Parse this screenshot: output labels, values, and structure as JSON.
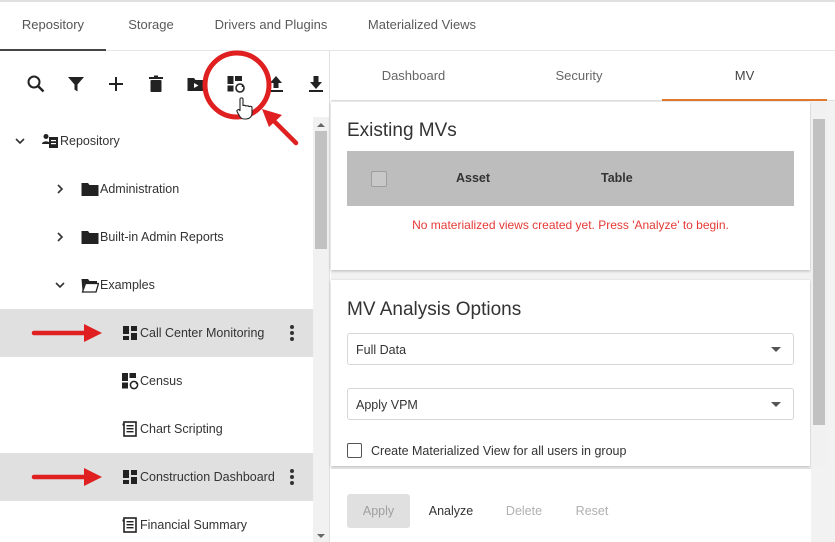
{
  "top_tabs": [
    {
      "label": "Repository",
      "active": true
    },
    {
      "label": "Storage",
      "active": false
    },
    {
      "label": "Drivers and Plugins",
      "active": false
    },
    {
      "label": "Materialized Views",
      "active": false
    }
  ],
  "toolbar": {
    "icons": [
      "search-icon",
      "filter-icon",
      "add-icon",
      "delete-icon",
      "move-folder-icon",
      "materialize-icon",
      "upload-icon",
      "download-icon"
    ]
  },
  "tree": {
    "items": [
      {
        "label": "Repository",
        "icon": "repository-icon",
        "expanded": true,
        "selected": false
      },
      {
        "label": "Administration",
        "icon": "folder-icon",
        "expanded": false,
        "selected": false
      },
      {
        "label": "Built-in Admin Reports",
        "icon": "folder-icon",
        "expanded": false,
        "selected": false
      },
      {
        "label": "Examples",
        "icon": "folder-open-icon",
        "expanded": true,
        "selected": false
      },
      {
        "label": "Call Center Monitoring",
        "icon": "dashboard-icon",
        "selected": true
      },
      {
        "label": "Census",
        "icon": "materialized-dashboard-icon",
        "selected": false
      },
      {
        "label": "Chart Scripting",
        "icon": "report-icon",
        "selected": false
      },
      {
        "label": "Construction Dashboard",
        "icon": "dashboard-icon",
        "selected": true
      },
      {
        "label": "Financial Summary",
        "icon": "report-icon",
        "selected": false
      }
    ]
  },
  "right_tabs": [
    {
      "label": "Dashboard",
      "active": false
    },
    {
      "label": "Security",
      "active": false
    },
    {
      "label": "MV",
      "active": true
    }
  ],
  "existing_mvs": {
    "title": "Existing MVs",
    "columns": [
      "Asset",
      "Table"
    ],
    "empty_message": "No materialized views created yet. Press 'Analyze' to begin."
  },
  "analysis": {
    "title": "MV Analysis Options",
    "data_select": "Full Data",
    "vpm_select": "Apply VPM",
    "checkbox_label": "Create Materialized View for all users in group",
    "checkbox_checked": false
  },
  "footer": {
    "apply": "Apply",
    "analyze": "Analyze",
    "delete": "Delete",
    "reset": "Reset"
  },
  "colors": {
    "accent_tab": "#e07a2e",
    "annotation_red": "#e02020",
    "error_text": "#e53935",
    "selected_row": "#e0e0e0"
  }
}
